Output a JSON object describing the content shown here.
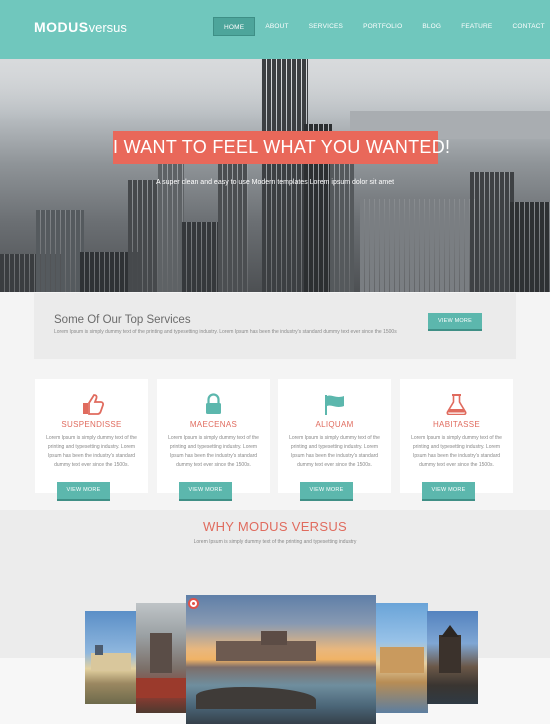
{
  "header": {
    "logo_bold": "MODUS",
    "logo_light": "versus",
    "nav": [
      "HOME",
      "ABOUT",
      "SERVICES",
      "PORTFOLIO",
      "BLOG",
      "FEATURE",
      "CONTACT"
    ],
    "active_index": 0,
    "colors": {
      "header_bg": "#70c7bd",
      "active_tab": "#4da59b"
    }
  },
  "hero": {
    "headline": "I WANT TO FEEL WHAT YOU WANTED!",
    "subtitle": "A super clean and easy to use Modern templates Lorem ipsum dolor sit amet",
    "colors": {
      "banner": "#e9685a"
    }
  },
  "services": {
    "title": "Some Of Our Top Services",
    "description": "Lorem Ipsum is simply dummy text of the printing and typesetting industry. Lorem Ipsum has been the industry's standard dummy text ever since the 1500s",
    "button": "VIEW MORE"
  },
  "cards": [
    {
      "icon": "thumbs-up-icon",
      "title": "SUSPENDISSE",
      "text": "Lorem Ipsum is simply dummy text of the printing and typesetting industry. Lorem Ipsum has been the industry's standard dummy text ever since the 1500s.",
      "button": "VIEW MORE"
    },
    {
      "icon": "lock-icon",
      "title": "MAECENAS",
      "text": "Lorem Ipsum is simply dummy text of the printing and typesetting industry. Lorem Ipsum has been the industry's standard dummy text ever since the 1500s.",
      "button": "VIEW MORE"
    },
    {
      "icon": "flag-icon",
      "title": "ALIQUAM",
      "text": "Lorem Ipsum is simply dummy text of the printing and typesetting industry. Lorem Ipsum has been the industry's standard dummy text ever since the 1500s.",
      "button": "VIEW MORE"
    },
    {
      "icon": "flask-icon",
      "title": "HABITASSE",
      "text": "Lorem Ipsum is simply dummy text of the printing and typesetting industry. Lorem Ipsum has been the industry's standard dummy text ever since the 1500s.",
      "button": "VIEW MORE"
    }
  ],
  "why": {
    "title": "WHY MODUS VERSUS",
    "subtitle": "Lorem Ipsum is simply dummy text of the printing and typesetting industry",
    "colors": {
      "accent": "#e06b5e",
      "button": "#5cb7ad"
    }
  }
}
